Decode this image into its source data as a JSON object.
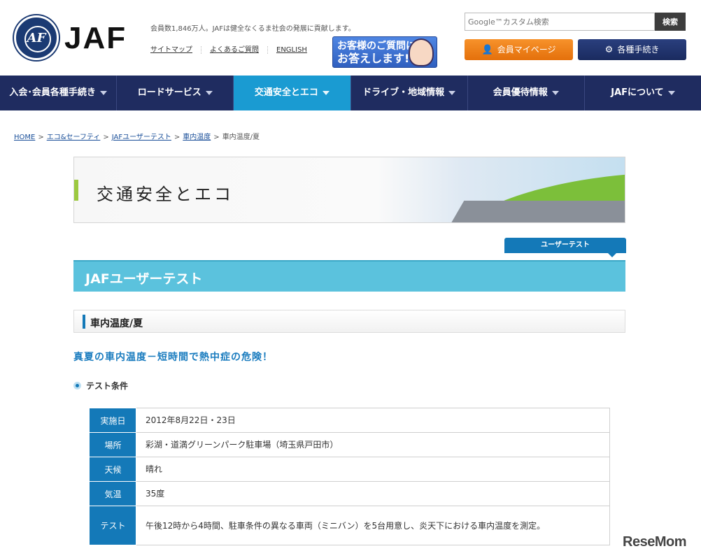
{
  "logo": {
    "emblem": "AF",
    "text": "JAF"
  },
  "header": {
    "tagline": "会員数1,846万人。JAFは健全なくるま社会の発展に貢献します。",
    "links": [
      "サイトマップ",
      "よくあるご質問",
      "ENGLISH"
    ],
    "qa_banner": {
      "line1": "お客様のご質問に",
      "line2": "お答えします!"
    },
    "search": {
      "placeholder": "Google™カスタム検索",
      "button": "検索"
    },
    "mypage_button": "会員マイページ",
    "procedures_button": "各種手続き"
  },
  "nav": {
    "items": [
      {
        "label": "入会･会員各種手続き"
      },
      {
        "label": "ロードサービス"
      },
      {
        "label": "交通安全とエコ"
      },
      {
        "label": "ドライブ・地域情報"
      },
      {
        "label": "会員優待情報"
      },
      {
        "label": "JAFについて"
      }
    ],
    "active": 2
  },
  "breadcrumb": {
    "items": [
      "HOME",
      "エコ&セーフティ",
      "JAFユーザーテスト",
      "車内温度",
      "車内温度/夏"
    ]
  },
  "hero": {
    "title": "交通安全とエコ"
  },
  "tab": {
    "label": "ユーザーテスト"
  },
  "section": {
    "title": "JAFユーザーテスト"
  },
  "subsection": {
    "title": "車内温度/夏"
  },
  "lead": "真夏の車内温度－短時間で熱中症の危険！",
  "conditions": {
    "heading": "テスト条件",
    "rows": [
      {
        "label": "実施日",
        "value": "2012年8月22日・23日"
      },
      {
        "label": "場所",
        "value": "彩湖・道満グリーンパーク駐車場（埼玉県戸田市）"
      },
      {
        "label": "天候",
        "value": "晴れ"
      },
      {
        "label": "気温",
        "value": "35度"
      },
      {
        "label": "テスト",
        "value": "午後12時から4時間、駐車条件の異なる車両（ミニバン）を5台用意し、炎天下における車内温度を測定。"
      }
    ]
  },
  "watermark": "ReseMom",
  "colors": {
    "nav_bg": "#1f2c60",
    "nav_active": "#1a9bd2",
    "accent_blue": "#1479b8",
    "section_bg": "#5bc2dd",
    "orange": "#f7922b"
  }
}
